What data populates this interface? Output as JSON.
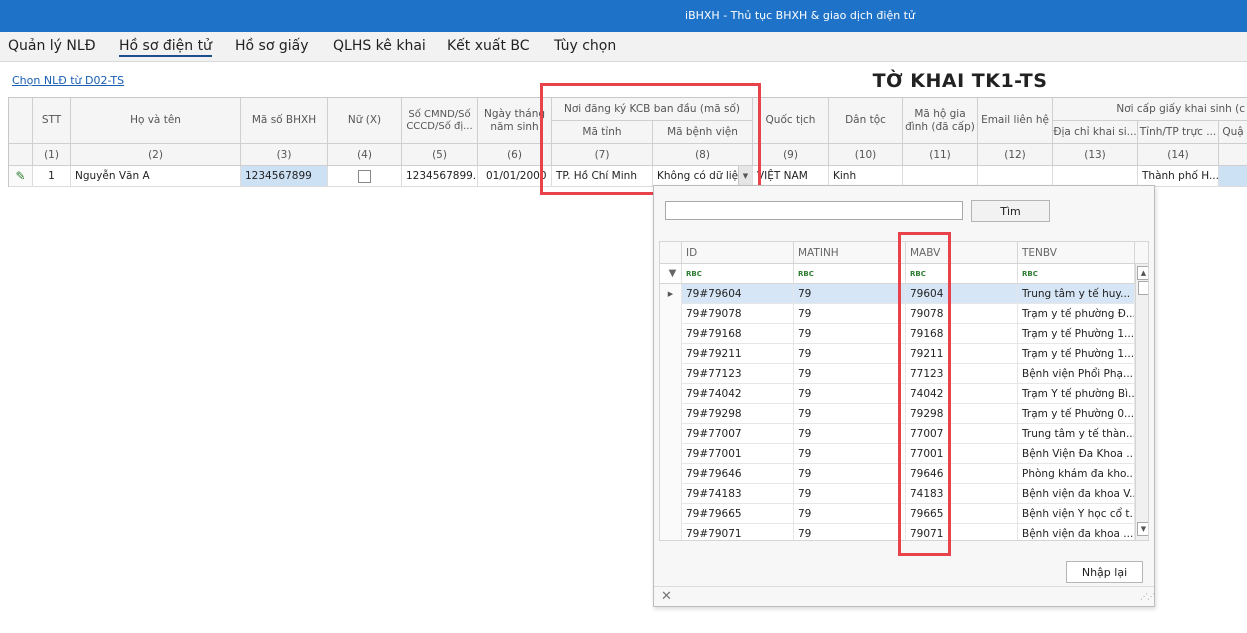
{
  "window": {
    "title": "iBHXH - Thủ tục BHXH & giao dịch điện tử"
  },
  "menu": [
    {
      "label": "Quản lý NLĐ",
      "active": false
    },
    {
      "label": "Hồ sơ điện tử",
      "active": true
    },
    {
      "label": "Hồ sơ giấy",
      "active": false
    },
    {
      "label": "QLHS kê khai",
      "active": false
    },
    {
      "label": "Kết xuất BC",
      "active": false
    },
    {
      "label": "Tùy chọn",
      "active": false
    }
  ],
  "form": {
    "pick_link": "Chọn NLĐ từ D02-TS",
    "title": "TỜ KHAI TK1-TS"
  },
  "grid": {
    "group_headers": {
      "kcb": "Nơi đăng ký KCB ban đầu (mã số)",
      "birth_cert": "Nơi cấp giấy khai sinh (c"
    },
    "columns": {
      "stt": "STT",
      "name": "Họ và tên",
      "bhxh": "Mã số BHXH",
      "female": "Nữ (X)",
      "cmnd": "Số CMND/Số CCCD/Số đị...",
      "dob": "Ngày tháng năm sinh",
      "province": "Mã tỉnh",
      "hospital": "Mã bệnh viện",
      "nationality": "Quốc tịch",
      "ethnic": "Dân tộc",
      "household": "Mã hộ gia đình (đã cấp)",
      "email": "Email liên hệ",
      "address": "Địa chỉ khai si...",
      "city": "Tỉnh/TP trực ...",
      "district": "Quậ"
    },
    "numbers": [
      "(1)",
      "(2)",
      "(3)",
      "(4)",
      "(5)",
      "(6)",
      "(7)",
      "(8)",
      "(9)",
      "(10)",
      "(11)",
      "(12)",
      "(13)",
      "(14)"
    ],
    "row": {
      "stt": "1",
      "name": "Nguyễn Văn A",
      "bhxh": "1234567899",
      "cmnd": "1234567899...",
      "dob": "01/01/2000",
      "province": "TP. Hồ Chí Minh",
      "hospital": "Không có dữ liệu",
      "nationality": "VIỆT NAM",
      "ethnic": "Kinh",
      "city": "Thành phố H..."
    }
  },
  "popup": {
    "search_value": "",
    "find_label": "Tìm",
    "reset_label": "Nhập lại",
    "filter_icon_text": "RBC",
    "columns": [
      "ID",
      "MATINH",
      "MABV",
      "TENBV"
    ],
    "rows": [
      [
        "79#79604",
        "79",
        "79604",
        "Trung tâm y tế huy..."
      ],
      [
        "79#79078",
        "79",
        "79078",
        "Trạm y tế phường Đ..."
      ],
      [
        "79#79168",
        "79",
        "79168",
        "Trạm y tế Phường 1..."
      ],
      [
        "79#79211",
        "79",
        "79211",
        "Trạm y tế Phường 1..."
      ],
      [
        "79#77123",
        "79",
        "77123",
        "Bệnh viện Phổi Phạ..."
      ],
      [
        "79#74042",
        "79",
        "74042",
        "Trạm Y tế phường Bì..."
      ],
      [
        "79#79298",
        "79",
        "79298",
        "Trạm y tế Phường 0..."
      ],
      [
        "79#77007",
        "79",
        "77007",
        "Trung tâm y tế thàn..."
      ],
      [
        "79#77001",
        "79",
        "77001",
        "Bệnh Viện Đa Khoa ..."
      ],
      [
        "79#79646",
        "79",
        "79646",
        "Phòng khám đa kho..."
      ],
      [
        "79#74183",
        "79",
        "74183",
        "Bệnh viện đa khoa V..."
      ],
      [
        "79#79665",
        "79",
        "79665",
        "Bệnh viện Y học cổ t..."
      ],
      [
        "79#79071",
        "79",
        "79071",
        "Bệnh viện đa khoa ..."
      ]
    ]
  },
  "colors": {
    "titlebar": "#1e73c9",
    "highlight": "#e8424a",
    "selected_row": "#d6e6f6"
  }
}
